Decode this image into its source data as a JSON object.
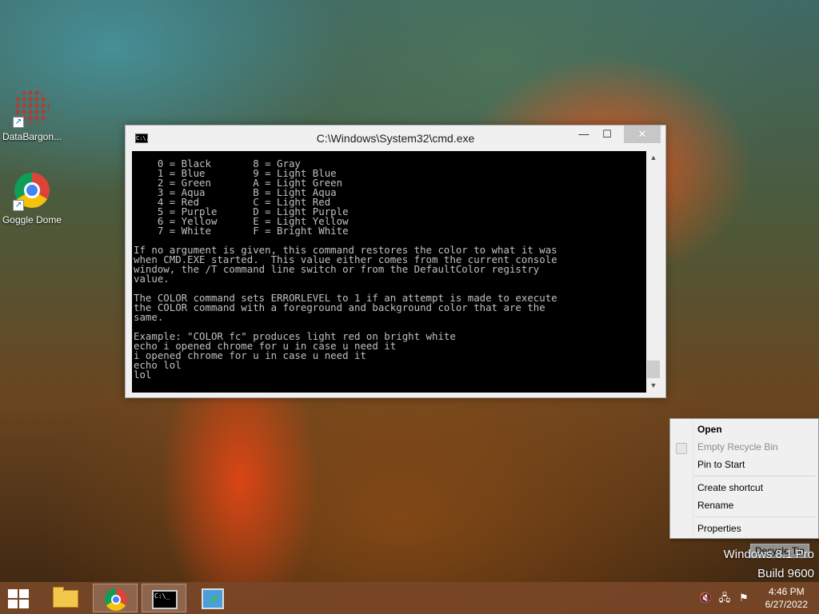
{
  "desktop": {
    "icons": [
      {
        "label": "DataBargon..."
      },
      {
        "label": "Goggle Dome"
      }
    ],
    "recycle_label": "Decycle Tin",
    "watermark_line1": "Windows 8.1 Pro",
    "watermark_line2": "Build 9600"
  },
  "cmd_window": {
    "title": "C:\\Windows\\System32\\cmd.exe",
    "icon_text": "C:\\.",
    "console_text": "    0 = Black       8 = Gray\n    1 = Blue        9 = Light Blue\n    2 = Green       A = Light Green\n    3 = Aqua        B = Light Aqua\n    4 = Red         C = Light Red\n    5 = Purple      D = Light Purple\n    6 = Yellow      E = Light Yellow\n    7 = White       F = Bright White\n\nIf no argument is given, this command restores the color to what it was\nwhen CMD.EXE started.  This value either comes from the current console\nwindow, the /T command line switch or from the DefaultColor registry\nvalue.\n\nThe COLOR command sets ERRORLEVEL to 1 if an attempt is made to execute\nthe COLOR command with a foreground and background color that are the\nsame.\n\nExample: \"COLOR fc\" produces light red on bright white\necho i opened chrome for u in case u need it\ni opened chrome for u in case u need it\necho lol\nlol",
    "buttons": {
      "minimize": "—",
      "maximize": "☐",
      "close": "✕"
    },
    "scroll_up": "▲",
    "scroll_down": "▼"
  },
  "context_menu": {
    "items": [
      {
        "label": "Open"
      },
      {
        "label": "Empty Recycle Bin"
      },
      {
        "label": "Pin to Start"
      },
      {
        "label": "Create shortcut"
      },
      {
        "label": "Rename"
      },
      {
        "label": "Properties"
      }
    ]
  },
  "taskbar": {
    "cmd_icon_text": "C:\\_",
    "tray": {
      "volume": "🔇",
      "network": "🖧",
      "flag": "⚑"
    },
    "clock_time": "4:46 PM",
    "clock_date": "6/27/2022"
  }
}
